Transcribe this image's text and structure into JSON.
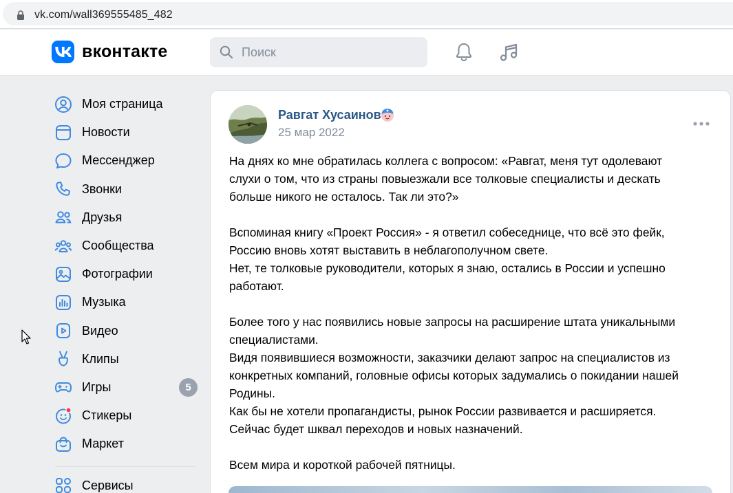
{
  "browser": {
    "url": "vk.com/wall369555485_482"
  },
  "header": {
    "logo_text": "вконтакте",
    "search_placeholder": "Поиск",
    "icons": [
      "bell-icon",
      "music-note-icon"
    ],
    "accent": "#0077ff"
  },
  "sidebar": {
    "items": [
      {
        "label": "Моя страница",
        "icon": "profile-icon"
      },
      {
        "label": "Новости",
        "icon": "news-icon"
      },
      {
        "label": "Мессенджер",
        "icon": "messenger-icon"
      },
      {
        "label": "Звонки",
        "icon": "phone-icon"
      },
      {
        "label": "Друзья",
        "icon": "friends-icon"
      },
      {
        "label": "Сообщества",
        "icon": "communities-icon"
      },
      {
        "label": "Фотографии",
        "icon": "photos-icon"
      },
      {
        "label": "Музыка",
        "icon": "music-icon"
      },
      {
        "label": "Видео",
        "icon": "video-icon"
      },
      {
        "label": "Клипы",
        "icon": "clips-icon"
      },
      {
        "label": "Игры",
        "icon": "games-icon",
        "badge": "5"
      },
      {
        "label": "Стикеры",
        "icon": "stickers-icon"
      },
      {
        "label": "Маркет",
        "icon": "market-icon"
      }
    ],
    "services_label": "Сервисы"
  },
  "post": {
    "author": "Равгат Хусаинов",
    "date": "25 мар 2022",
    "paragraphs": [
      "На днях ко мне обратилась коллега с вопросом: «Равгат, меня тут одолевают\nслухи о том, что из страны повыезжали все толковые специалисты и дескать\nбольше никого не осталось. Так ли это?»",
      "Вспоминая книгу «Проект Россия» - я ответил собеседнице, что всё это фейк,\nРоссию вновь хотят выставить в неблагополучном свете.\nНет, те толковые руководители, которых я знаю, остались в России и успешно\nработают.",
      "Более того у нас появились новые запросы на расширение штата уникальными\nспециалистами.\nВидя появившиеся возможности, заказчики делают запрос на специалистов из\nконкретных компаний, головные офисы которых задумались о покидании нашей\nРодины.\nКак бы не хотели пропагандисты, рынок России развивается и расширяется.\nСейчас будет шквал переходов и новых назначений.",
      "Всем мира и короткой рабочей пятницы."
    ]
  }
}
